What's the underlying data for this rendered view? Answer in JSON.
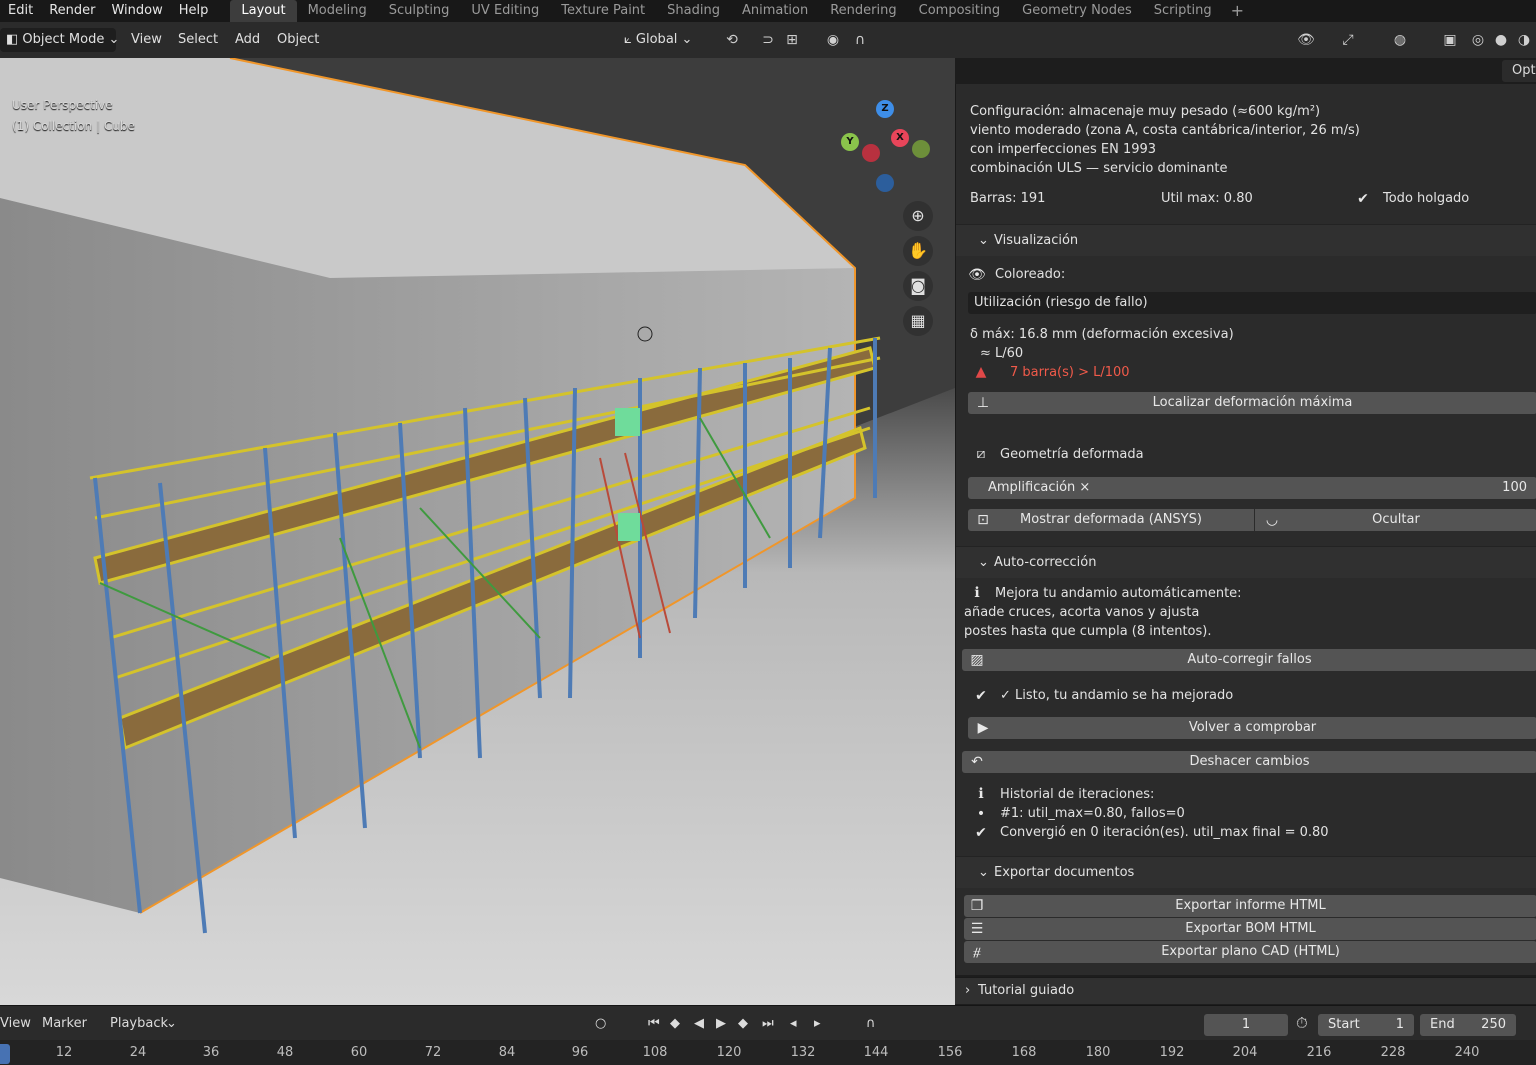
{
  "topbar": {
    "menus": [
      "Edit",
      "Render",
      "Window",
      "Help"
    ],
    "workspaces": [
      "Layout",
      "Modeling",
      "Sculpting",
      "UV Editing",
      "Texture Paint",
      "Shading",
      "Animation",
      "Rendering",
      "Compositing",
      "Geometry Nodes",
      "Scripting"
    ],
    "active_workspace": "Layout",
    "add_tab": "+"
  },
  "header": {
    "mode": "Object Mode",
    "menus": [
      "View",
      "Select",
      "Add",
      "Object"
    ],
    "transform_orientation": "Global",
    "options_label": "Opti"
  },
  "viewport": {
    "perspective": "User Perspective",
    "collection": "(1) Collection | Cube",
    "gizmo_axes": {
      "x": "X",
      "y": "Y",
      "z": "Z"
    },
    "colors": {
      "x": "#e8455a",
      "y": "#8ac44b",
      "z": "#3e8ee8"
    }
  },
  "panel": {
    "config_lines": [
      "Configuración: almacenaje muy pesado (≈600 kg/m²)",
      "viento moderado (zona A, costa cantábrica/interior, 26 m/s)",
      "con imperfecciones EN 1993",
      "combinación ULS — servicio dominante"
    ],
    "bars": "Barras: 191",
    "util_max": "Util max: 0.80",
    "status": "Todo holgado",
    "visualization": {
      "title": "Visualización",
      "coloring_label": "Coloreado:",
      "coloring_value": "Utilización (riesgo de fallo)",
      "delta_line": "δ máx: 16.8 mm  (deformación excesiva)",
      "ratio_line": "≈ L/60",
      "warning": "7 barra(s) > L/100",
      "locate_button": "Localizar deformación máxima",
      "deformed_label": "Geometría deformada",
      "amplification_label": "Amplificación ×",
      "amplification_value": "100",
      "show_button": "Mostrar deformada (ANSYS)",
      "hide_button": "Ocultar"
    },
    "autocorrect": {
      "title": "Auto-corrección",
      "info_lines": [
        "Mejora tu andamio automáticamente:",
        "añade cruces, acorta vanos y ajusta",
        "postes hasta que cumpla (8 intentos)."
      ],
      "autocorrect_button": "Auto-corregir fallos",
      "done_text": "✓ Listo, tu andamio se ha mejorado",
      "recheck_button": "Volver a comprobar",
      "undo_button": "Deshacer cambios",
      "history_title": "Historial de iteraciones:",
      "history_item": "#1: util_max=0.80, fallos=0",
      "converged": "Convergió en 0 iteración(es). util_max final = 0.80"
    },
    "export": {
      "title": "Exportar documentos",
      "buttons": [
        "Exportar informe HTML",
        "Exportar BOM HTML",
        "Exportar plano CAD (HTML)"
      ]
    },
    "tutorial": "Tutorial guiado"
  },
  "timeline": {
    "menus": [
      "View",
      "Marker",
      "Playback"
    ],
    "current_frame": "1",
    "start_label": "Start",
    "start_value": "1",
    "end_label": "End",
    "end_value": "250",
    "ticks": [
      "12",
      "24",
      "36",
      "48",
      "60",
      "72",
      "84",
      "96",
      "108",
      "120",
      "132",
      "144",
      "156",
      "168",
      "180",
      "192",
      "204",
      "216",
      "228",
      "240"
    ]
  }
}
